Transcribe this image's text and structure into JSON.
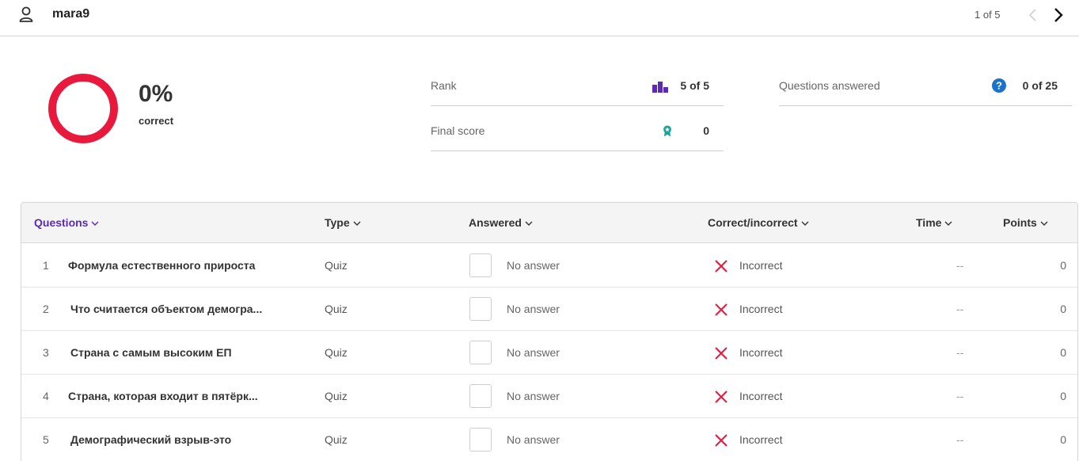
{
  "header": {
    "username": "mara9",
    "pager": "1 of 5"
  },
  "summary": {
    "percent": "0%",
    "percent_label": "correct",
    "percent_value": 0,
    "ring_color": "#e8193c",
    "rank_label": "Rank",
    "rank_value": "5 of 5",
    "final_score_label": "Final score",
    "final_score_value": "0",
    "questions_answered_label": "Questions answered",
    "questions_answered_value": "0 of 25"
  },
  "colors": {
    "accent": "#5b2bb5",
    "incorrect": "#e8193c",
    "teal": "#1aa39a",
    "help": "#1a73c8"
  },
  "table": {
    "headers": {
      "questions": "Questions",
      "type": "Type",
      "answered": "Answered",
      "correct": "Correct/incorrect",
      "time": "Time",
      "points": "Points"
    },
    "rows": [
      {
        "num": "1",
        "question": "Формула естественного прироста",
        "type": "Quiz",
        "answer": "No answer",
        "result": "Incorrect",
        "time": "--",
        "points": "0"
      },
      {
        "num": "2",
        "question": "Что считается объектом демогра...",
        "type": "Quiz",
        "answer": "No answer",
        "result": "Incorrect",
        "time": "--",
        "points": "0"
      },
      {
        "num": "3",
        "question": "Страна с самым высоким ЕП",
        "type": "Quiz",
        "answer": "No answer",
        "result": "Incorrect",
        "time": "--",
        "points": "0"
      },
      {
        "num": "4",
        "question": "Страна, которая входит в пятёрк...",
        "type": "Quiz",
        "answer": "No answer",
        "result": "Incorrect",
        "time": "--",
        "points": "0"
      },
      {
        "num": "5",
        "question": "Демографический взрыв-это",
        "type": "Quiz",
        "answer": "No answer",
        "result": "Incorrect",
        "time": "--",
        "points": "0"
      }
    ]
  }
}
